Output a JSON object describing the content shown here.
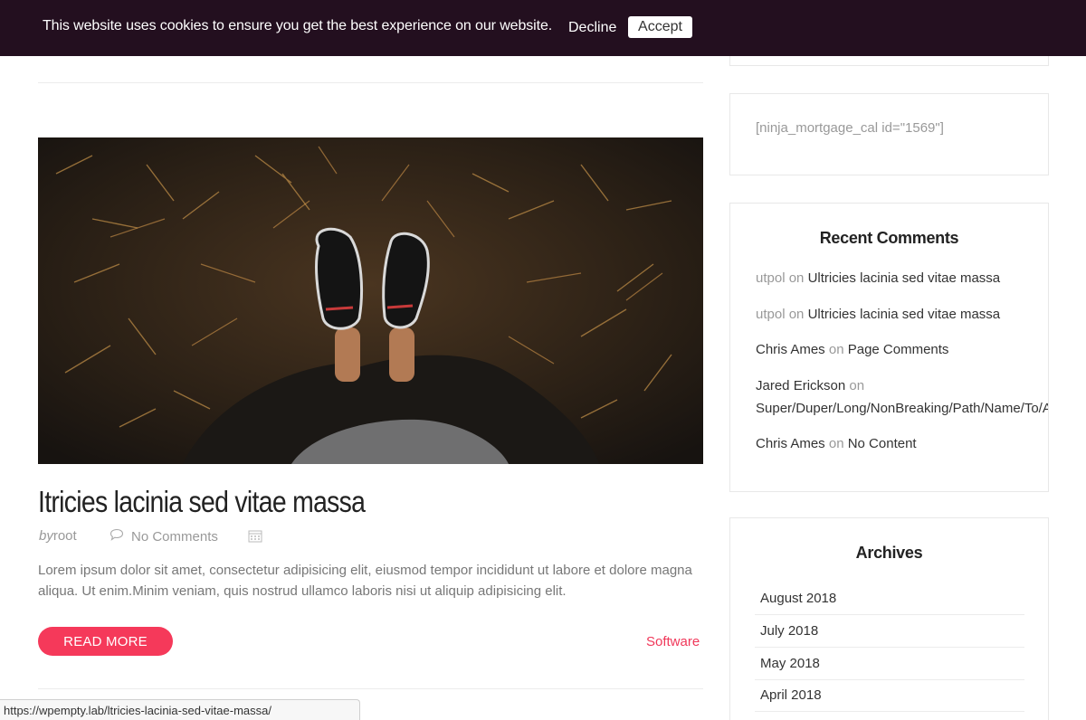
{
  "cookie_bar": {
    "message": "This website uses cookies to ensure you get the best experience on our website.",
    "decline_label": "Decline",
    "accept_label": "Accept",
    "background": "#230f1f"
  },
  "post": {
    "image_alt": "feet-in-dry-grass-photo",
    "title": "Itricies lacinia sed vitae massa",
    "by_label": "by",
    "author": "root",
    "comments": "No Comments",
    "excerpt": "Lorem ipsum dolor sit amet, consectetur adipisicing elit, eiusmod tempor incididunt ut labore et dolore magna aliqua. Ut enim.Minim veniam, quis nostrud ullamco laboris nisi ut aliquip adipisicing elit.",
    "read_more_label": "READ MORE",
    "category": "Software",
    "accent_color": "#f5395a"
  },
  "sidebar": {
    "shortcode_text": "[ninja_mortgage_cal id=\"1569\"]",
    "recent_comments": {
      "title": "Recent Comments",
      "on_word": "on",
      "items": [
        {
          "author": "utpol",
          "post": "Ultricies lacinia sed vitae massa"
        },
        {
          "author": "utpol",
          "post": "Ultricies lacinia sed vitae massa"
        },
        {
          "author": "Chris Ames",
          "post": "Page Comments"
        },
        {
          "author": "Jared Erickson",
          "post": "Super/Duper/Long/NonBreaking/Path/Name/To/A/Fi"
        },
        {
          "author": "Chris Ames",
          "post": "No Content"
        }
      ]
    },
    "archives": {
      "title": "Archives",
      "items": [
        "August 2018",
        "July 2018",
        "May 2018",
        "April 2018"
      ]
    }
  },
  "status_bar": {
    "url": "https://wpempty.lab/ltricies-lacinia-sed-vitae-massa/"
  },
  "icons": {
    "comment": "speech-bubble-icon",
    "calendar": "calendar-icon"
  }
}
